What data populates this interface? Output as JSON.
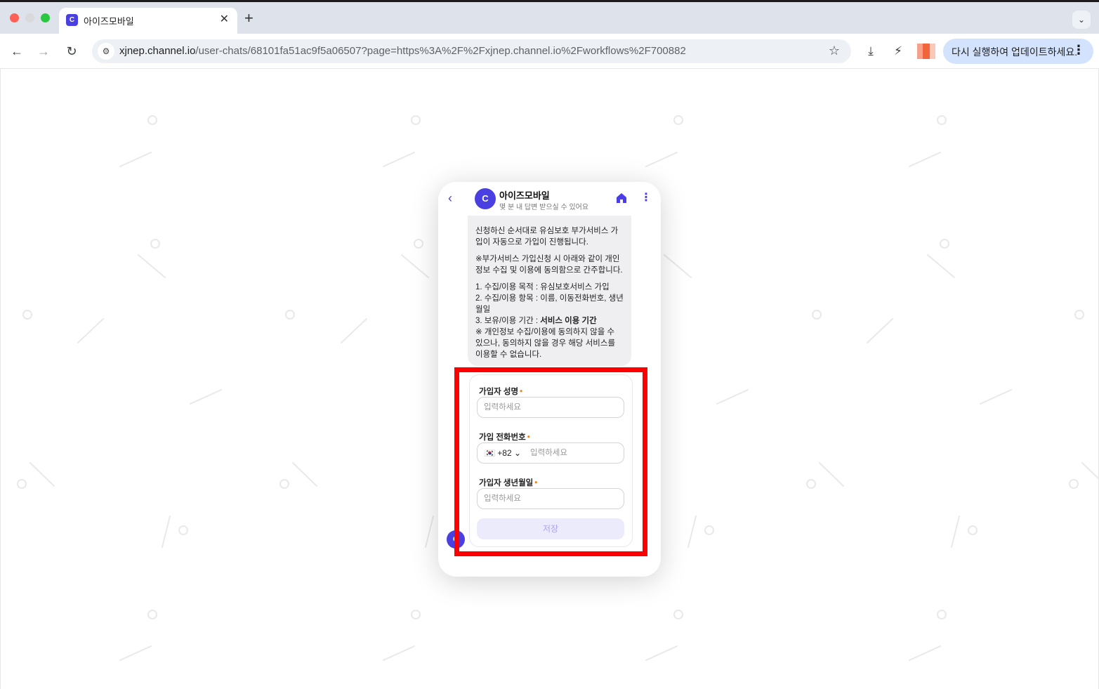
{
  "browser": {
    "tab_title": "아이즈모바일",
    "tab_favicon": "channel-talk-logo",
    "url_host": "xjnep.channel.io",
    "url_path": "/user-chats/68101fa51ac9f5a06507?page=https%3A%2F%2Fxjnep.channel.io%2Fworkflows%2F700882",
    "update_button_label": "다시 실행하여 업데이트하세요."
  },
  "messenger": {
    "channel_name": "아이즈모바일",
    "status_text": "몇 분 내 답변 받으실 수 있어요",
    "brand_color": "#4a3fe0",
    "message": {
      "para1": "신청하신 순서대로 유심보호 부가서비스 가입이 자동으로 가입이 진행됩니다.",
      "para2": "※부가서비스 가입신청 시 아래와 같이 개인정보 수집 및 이용에 동의함으로 간주합니다.",
      "item1": "1. 수집/이용 목적 : 유심보호서비스 가입",
      "item2": "2. 수집/이용 항목 : 이름, 이동전화번호, 생년월일",
      "item3_prefix": "3. 보유/이용 기간 : ",
      "item3_bold": "서비스 이용 기간",
      "note": "※ 개인정보 수집/이용에 동의하지 않을 수 있으나, 동의하지 않을 경우 해당 서비스를 이용할 수 없습니다."
    },
    "form": {
      "name_label": "가입자 성명",
      "name_placeholder": "입력하세요",
      "phone_label": "가입 전화번호",
      "phone_country_flag": "🇰🇷",
      "phone_country_code": "+82",
      "phone_placeholder": "입력하세요",
      "birth_label": "가입자 생년월일",
      "birth_placeholder": "입력하세요",
      "save_label": "저장",
      "required_color": "#f08a1c"
    }
  },
  "annotation": {
    "highlight_color": "#ff0000"
  }
}
